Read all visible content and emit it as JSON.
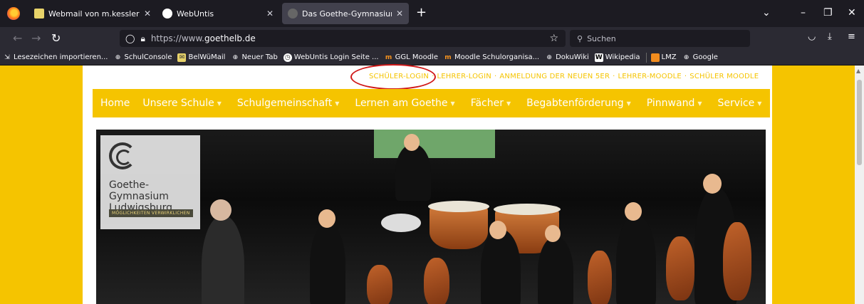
{
  "browser": {
    "tabs": [
      {
        "title": "Webmail von m.kessler@goethe",
        "active": false
      },
      {
        "title": "WebUntis",
        "active": false
      },
      {
        "title": "Das Goethe-Gymnasium Ludwi",
        "active": true
      }
    ],
    "url_prefix": "https://www.",
    "url_domain": "goethelb.de",
    "search_placeholder": "Suchen",
    "bookmarks": [
      {
        "label": "Lesezeichen importieren...",
        "icon": "import-icon"
      },
      {
        "label": "SchulConsole",
        "icon": "globe-icon"
      },
      {
        "label": "BelWüMail",
        "icon": "mail-icon"
      },
      {
        "label": "Neuer Tab",
        "icon": "globe-icon"
      },
      {
        "label": "WebUntis Login Seite ...",
        "icon": "clock-icon"
      },
      {
        "label": "GGL Moodle",
        "icon": "moodle-icon"
      },
      {
        "label": "Moodle Schulorganisa...",
        "icon": "moodle-icon"
      },
      {
        "label": "DokuWiki",
        "icon": "globe-icon"
      },
      {
        "label": "Wikipedia",
        "icon": "wikipedia-icon"
      },
      {
        "label": "LMZ",
        "icon": "lmz-icon"
      },
      {
        "label": "Google",
        "icon": "globe-icon"
      }
    ]
  },
  "site": {
    "top_links": [
      "SCHÜLER-LOGIN",
      "LEHRER-LOGIN",
      "ANMELDUNG DER NEUEN 5ER",
      "LEHRER-MOODLE",
      "SCHÜLER MOODLE"
    ],
    "nav": [
      {
        "label": "Home",
        "dropdown": false
      },
      {
        "label": "Unsere Schule",
        "dropdown": true
      },
      {
        "label": "Schulgemeinschaft",
        "dropdown": true
      },
      {
        "label": "Lernen am Goethe",
        "dropdown": true
      },
      {
        "label": "Fächer",
        "dropdown": true
      },
      {
        "label": "Begabtenförderung",
        "dropdown": true
      },
      {
        "label": "Pinnwand",
        "dropdown": true
      },
      {
        "label": "Service",
        "dropdown": true
      }
    ],
    "logo_line1": "Goethe-Gymnasium",
    "logo_line2": "Ludwigsburg",
    "logo_tagline": "MÖGLICHKEITEN VERWIRKLICHEN",
    "colors": {
      "brand_yellow": "#f5c400",
      "annotation_red": "#d01818"
    }
  }
}
